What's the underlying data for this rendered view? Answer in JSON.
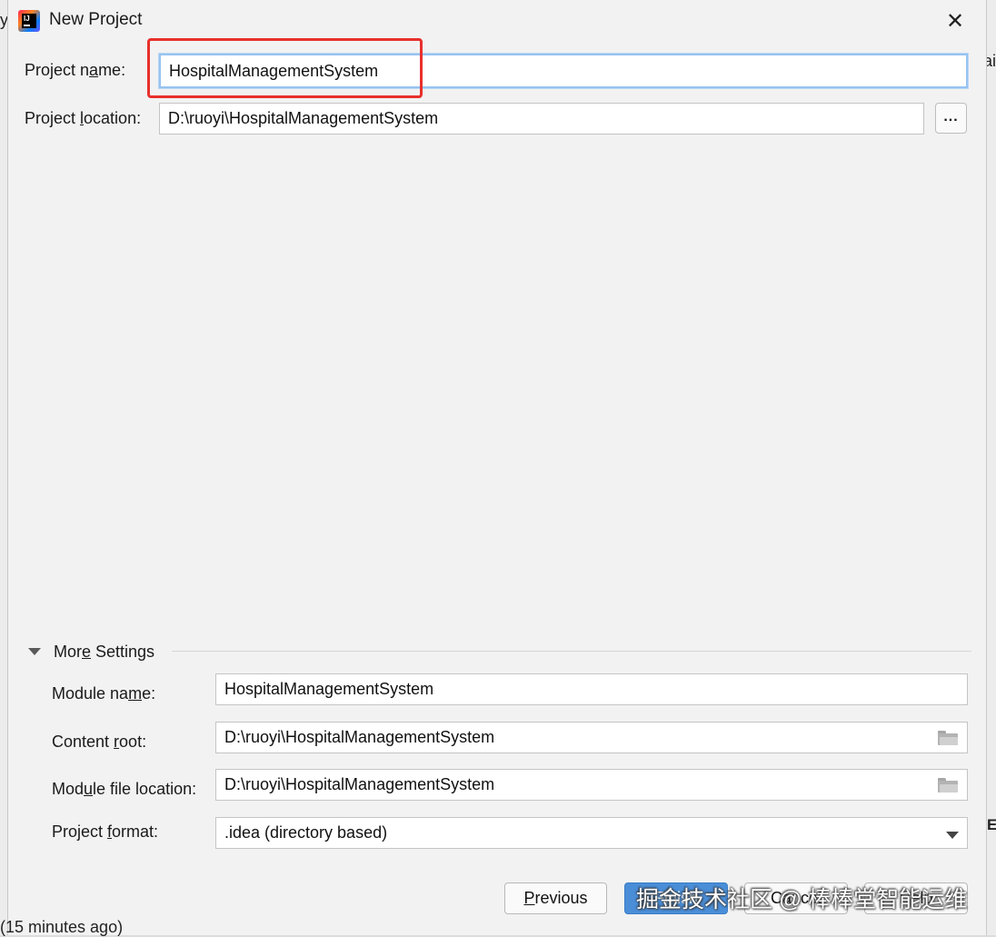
{
  "background": {
    "left_fragment": "y",
    "right_fragment": "ai",
    "right_fragment_2": "E",
    "bottom_fragment": "(15 minutes ago)"
  },
  "dialog": {
    "title": "New Project",
    "close_glyph": "✕",
    "app_icon_glyph": "IJ"
  },
  "project": {
    "name_label_pre": "Project n",
    "name_label_mn": "a",
    "name_label_post": "me:",
    "name_value": "HospitalManagementSystem",
    "location_label_pre": "Project ",
    "location_label_mn": "l",
    "location_label_post": "ocation:",
    "location_value": "D:\\ruoyi\\HospitalManagementSystem",
    "browse_label": "..."
  },
  "more_settings": {
    "title_pre": "Mor",
    "title_mn": "e",
    "title_post": " Settings",
    "module_name_label_pre": "Module na",
    "module_name_label_mn": "m",
    "module_name_label_post": "e:",
    "module_name_value": "HospitalManagementSystem",
    "content_root_label_pre": "Content ",
    "content_root_label_mn": "r",
    "content_root_label_post": "oot:",
    "content_root_value": "D:\\ruoyi\\HospitalManagementSystem",
    "module_file_label_pre": "Mod",
    "module_file_label_mn": "u",
    "module_file_label_post": "le file location:",
    "module_file_value": "D:\\ruoyi\\HospitalManagementSystem",
    "project_format_label_pre": "Project ",
    "project_format_label_mn": "f",
    "project_format_label_post": "ormat:",
    "project_format_value": ".idea (directory based)"
  },
  "footer": {
    "previous_mn": "P",
    "previous_rest": "revious",
    "finish_label": "Finish",
    "cancel_label": "Cancel",
    "help_label": "Help"
  },
  "watermark": "掘金技术社区 @ 棒棒堂智能运维",
  "colors": {
    "highlight": "#e8302c",
    "focus": "#97c3f0",
    "primary_button": "#4a8ed8"
  }
}
